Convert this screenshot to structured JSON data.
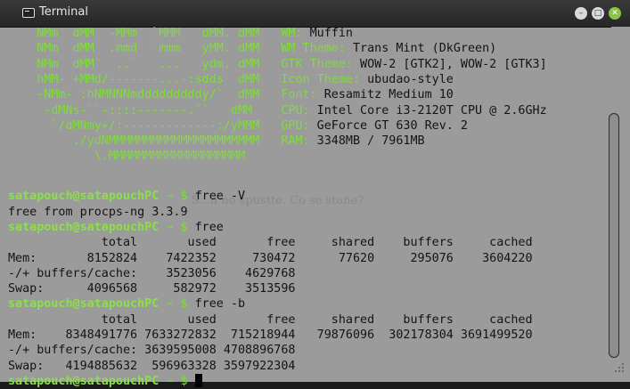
{
  "window": {
    "title": "Terminal"
  },
  "ghost_text": "Š...n no spustte. Co se stane?",
  "logo_lines": [
    "    NMm  dMM  -MMm  `MMM   dMM. dMM",
    "    NMm  dMM  .mmd  `mmm   yMM. dMM",
    "    NMm  dMM`  ..`   ...   ydm. dMM",
    "    hMM- +MMd/-------...-:sdds  dMM",
    "    -NMm- :hNMNNNmdddddddddy/`  dMM",
    "     -dMNs-``-::::-------.``   dMM",
    "      `/dMNmy+/:-------------:/yMMM",
    "         ./ydNMMMMMMMMMMMMMMMMMMMMM",
    "            \\.MMMMMMMMMMMMMMMMMMM"
  ],
  "sysinfo": [
    {
      "label": "WM:",
      "value": "Muffin"
    },
    {
      "label": "WM Theme:",
      "value": "Trans Mint (DkGreen)"
    },
    {
      "label": "GTK Theme:",
      "value": "WOW-2 [GTK2], WOW-2 [GTK3]"
    },
    {
      "label": "Icon Theme:",
      "value": "ubudao-style"
    },
    {
      "label": "Font:",
      "value": "Resamitz Medium 10"
    },
    {
      "label": "CPU:",
      "value": "Intel Core i3-2120T CPU @ 2.6GHz"
    },
    {
      "label": "GPU:",
      "value": "GeForce GT 630 Rev. 2"
    },
    {
      "label": "RAM:",
      "value": "3348MB / 7961MB"
    }
  ],
  "prompt": {
    "user_host": "satapouch@satapouchPC",
    "path": "~",
    "symbol": "$"
  },
  "session": [
    {
      "type": "cmd",
      "text": "free -V"
    },
    {
      "type": "out",
      "text": "free from procps-ng 3.3.9"
    },
    {
      "type": "cmd",
      "text": "free"
    },
    {
      "type": "out",
      "text": "             total       used       free     shared    buffers     cached"
    },
    {
      "type": "out",
      "text": "Mem:       8152824    7422352     730472      77620     295076    3604220"
    },
    {
      "type": "out",
      "text": "-/+ buffers/cache:    3523056    4629768"
    },
    {
      "type": "out",
      "text": "Swap:      4096568     582972    3513596"
    },
    {
      "type": "cmd",
      "text": "free -b"
    },
    {
      "type": "out",
      "text": "             total       used       free     shared    buffers     cached"
    },
    {
      "type": "out",
      "text": "Mem:    8348491776 7633272832  715218944   79876096  302178304 3691499520"
    },
    {
      "type": "out",
      "text": "-/+ buffers/cache: 3639595008 4708896768"
    },
    {
      "type": "out",
      "text": "Swap:   4194885632  596963328 3597922304"
    },
    {
      "type": "cmd",
      "text": ""
    }
  ]
}
